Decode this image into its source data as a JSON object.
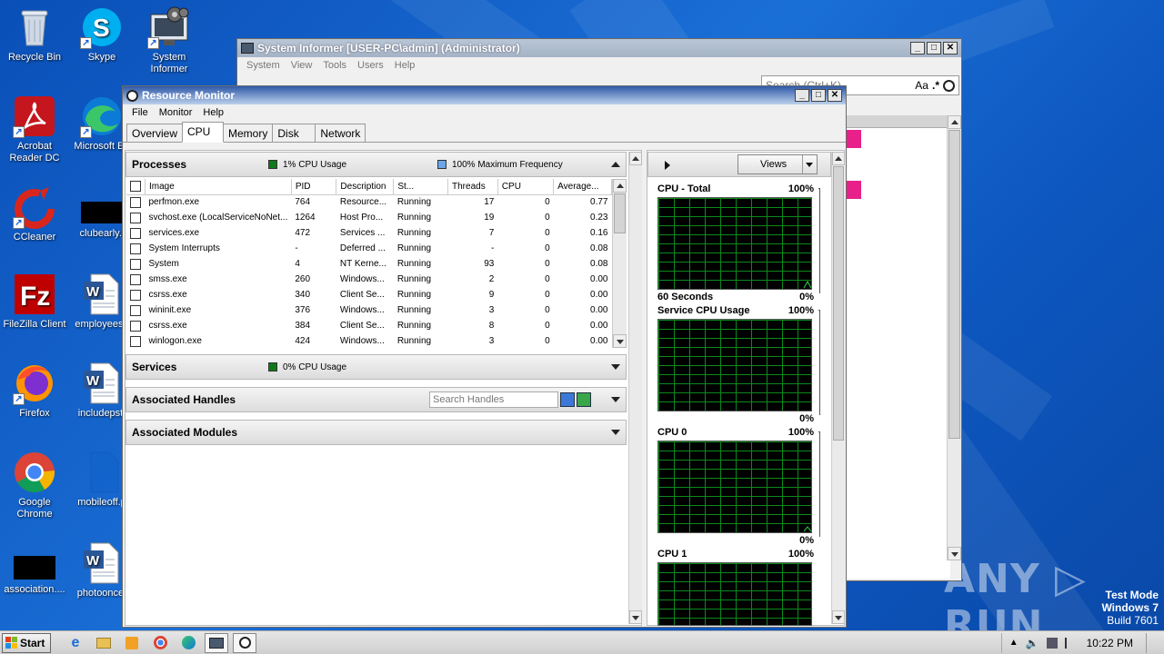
{
  "desktop": {
    "icons": [
      {
        "label": "Recycle Bin"
      },
      {
        "label": "Skype"
      },
      {
        "label": "System Informer"
      },
      {
        "label": "Acrobat Reader DC"
      },
      {
        "label": "Microsoft Ed"
      },
      {
        "label": "CCleaner"
      },
      {
        "label": "clubearly.j"
      },
      {
        "label": "FileZilla Client"
      },
      {
        "label": "employeesh"
      },
      {
        "label": "Firefox"
      },
      {
        "label": "includepst."
      },
      {
        "label": "Google Chrome"
      },
      {
        "label": "mobileoff.p"
      },
      {
        "label": "association...."
      },
      {
        "label": "photoonce."
      }
    ],
    "test_mode": {
      "line1": "Test Mode",
      "line2": "Windows 7",
      "line3": "Build 7601"
    },
    "watermark": "ANY ▷ RUN"
  },
  "system_informer": {
    "title": "System Informer [USER-PC\\admin] (Administrator)",
    "menu": [
      "System",
      "View",
      "Tools",
      "Users",
      "Help"
    ],
    "search_placeholder": "Search (Ctrl+K)",
    "aa": "Aa",
    "regex": ".*"
  },
  "resmon": {
    "title": "Resource Monitor",
    "menu": [
      "File",
      "Monitor",
      "Help"
    ],
    "tabs": [
      "Overview",
      "CPU",
      "Memory",
      "Disk",
      "Network"
    ],
    "processes": {
      "title": "Processes",
      "cpu_usage": "1% CPU Usage",
      "max_freq": "100% Maximum Frequency",
      "columns": [
        "Image",
        "PID",
        "Description",
        "St...",
        "Threads",
        "CPU",
        "Average..."
      ],
      "rows": [
        {
          "image": "perfmon.exe",
          "pid": "764",
          "desc": "Resource...",
          "status": "Running",
          "threads": "17",
          "cpu": "0",
          "avg": "0.77"
        },
        {
          "image": "svchost.exe (LocalServiceNoNet...",
          "pid": "1264",
          "desc": "Host Pro...",
          "status": "Running",
          "threads": "19",
          "cpu": "0",
          "avg": "0.23"
        },
        {
          "image": "services.exe",
          "pid": "472",
          "desc": "Services ...",
          "status": "Running",
          "threads": "7",
          "cpu": "0",
          "avg": "0.16"
        },
        {
          "image": "System Interrupts",
          "pid": "-",
          "desc": "Deferred ...",
          "status": "Running",
          "threads": "-",
          "cpu": "0",
          "avg": "0.08"
        },
        {
          "image": "System",
          "pid": "4",
          "desc": "NT Kerne...",
          "status": "Running",
          "threads": "93",
          "cpu": "0",
          "avg": "0.08"
        },
        {
          "image": "smss.exe",
          "pid": "260",
          "desc": "Windows...",
          "status": "Running",
          "threads": "2",
          "cpu": "0",
          "avg": "0.00"
        },
        {
          "image": "csrss.exe",
          "pid": "340",
          "desc": "Client Se...",
          "status": "Running",
          "threads": "9",
          "cpu": "0",
          "avg": "0.00"
        },
        {
          "image": "wininit.exe",
          "pid": "376",
          "desc": "Windows...",
          "status": "Running",
          "threads": "3",
          "cpu": "0",
          "avg": "0.00"
        },
        {
          "image": "csrss.exe",
          "pid": "384",
          "desc": "Client Se...",
          "status": "Running",
          "threads": "8",
          "cpu": "0",
          "avg": "0.00"
        },
        {
          "image": "winlogon.exe",
          "pid": "424",
          "desc": "Windows...",
          "status": "Running",
          "threads": "3",
          "cpu": "0",
          "avg": "0.00"
        }
      ]
    },
    "services": {
      "title": "Services",
      "cpu_usage": "0% CPU Usage"
    },
    "handles": {
      "title": "Associated Handles",
      "search_placeholder": "Search Handles"
    },
    "modules": {
      "title": "Associated Modules"
    },
    "graphs": {
      "views_label": "Views",
      "cpu_total": {
        "title": "CPU - Total",
        "max": "100%",
        "footer_left": "60 Seconds",
        "footer_right": "0%"
      },
      "service_cpu": {
        "title": "Service CPU Usage",
        "max": "100%",
        "footer_right": "0%"
      },
      "cpu0": {
        "title": "CPU 0",
        "max": "100%",
        "footer_right": "0%"
      },
      "cpu1": {
        "title": "CPU 1",
        "max": "100%"
      }
    }
  },
  "taskbar": {
    "start_label": "Start",
    "clock": "10:22 PM"
  },
  "colors": {
    "green_indicator": "#0f7a1a",
    "blue_indicator": "#6aa6e8",
    "graph_grid": "#0c8a1d",
    "pink_marker": "#e8208a"
  }
}
